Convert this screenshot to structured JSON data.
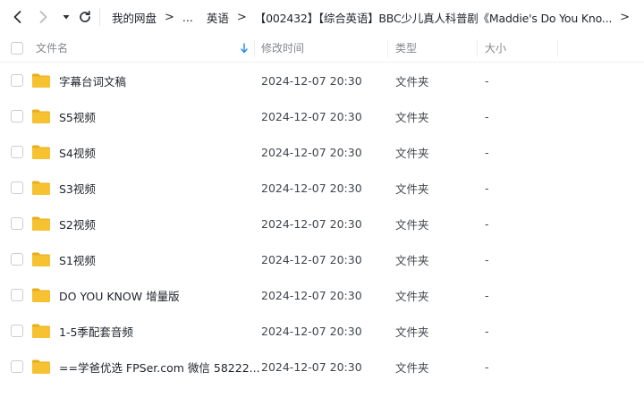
{
  "toolbar": {
    "back_icon": "chevron-left-icon",
    "forward_icon": "chevron-right-icon",
    "history_icon": "caret-down-icon",
    "refresh_icon": "refresh-icon"
  },
  "breadcrumb": [
    "我的网盘",
    "...",
    "英语",
    "【002432】【综合英语】BBC少儿真人科普剧《Maddie's Do You Kno..."
  ],
  "columns": {
    "name": "文件名",
    "modified": "修改时间",
    "type": "类型",
    "size": "大小",
    "sort_icon": "sort-down-arrow-icon"
  },
  "files": [
    {
      "name": "字幕台词文稿",
      "modified": "2024-12-07 20:30",
      "type": "文件夹",
      "size": "-"
    },
    {
      "name": "S5视频",
      "modified": "2024-12-07 20:30",
      "type": "文件夹",
      "size": "-"
    },
    {
      "name": "S4视频",
      "modified": "2024-12-07 20:30",
      "type": "文件夹",
      "size": "-"
    },
    {
      "name": "S3视频",
      "modified": "2024-12-07 20:30",
      "type": "文件夹",
      "size": "-"
    },
    {
      "name": "S2视频",
      "modified": "2024-12-07 20:30",
      "type": "文件夹",
      "size": "-"
    },
    {
      "name": "S1视频",
      "modified": "2024-12-07 20:30",
      "type": "文件夹",
      "size": "-"
    },
    {
      "name": "DO YOU KNOW 增量版",
      "modified": "2024-12-07 20:30",
      "type": "文件夹",
      "size": "-"
    },
    {
      "name": "1-5季配套音频",
      "modified": "2024-12-07 20:30",
      "type": "文件夹",
      "size": "-"
    },
    {
      "name": "==学爸优选 FPSer.com 微信 58222...",
      "modified": "2024-12-07 20:30",
      "type": "文件夹",
      "size": "-"
    }
  ],
  "colors": {
    "folder": "#f7c232",
    "folder_dark": "#e9ad1c",
    "sort_arrow": "#2d8cf0"
  }
}
